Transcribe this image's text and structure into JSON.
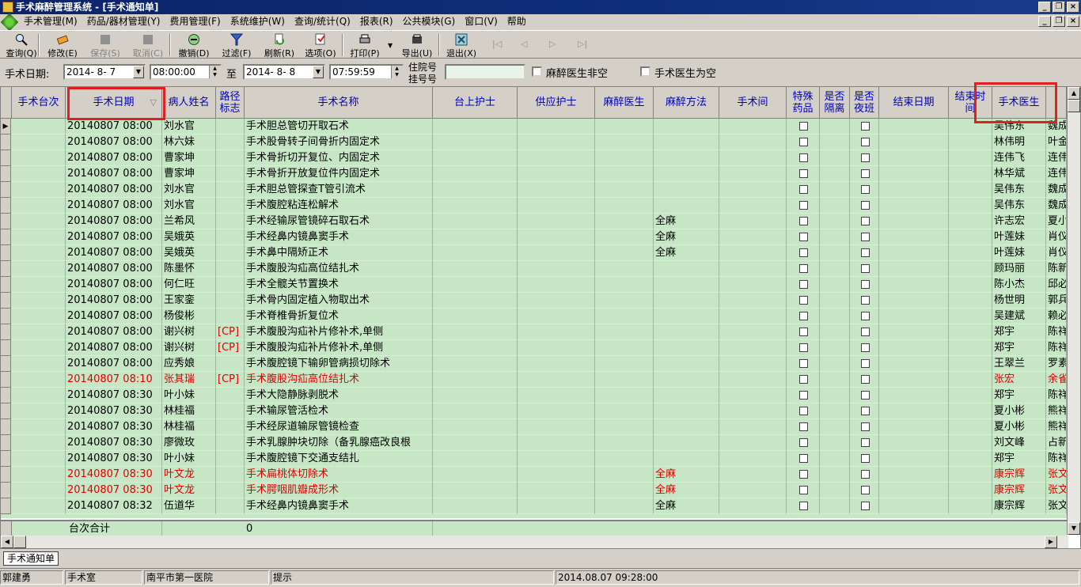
{
  "window": {
    "title": "手术麻醉管理系统 - [手术通知单]"
  },
  "menu": [
    "手术管理(M)",
    "药品/器材管理(Y)",
    "费用管理(F)",
    "系统维护(W)",
    "查询/统计(Q)",
    "报表(R)",
    "公共模块(G)",
    "窗口(V)",
    "帮助"
  ],
  "toolbar": [
    {
      "label": "查询(Q)",
      "icon": "search-icon",
      "enabled": true
    },
    {
      "label": "修改(E)",
      "icon": "edit-icon",
      "enabled": true
    },
    {
      "label": "保存(S)",
      "icon": "save-icon",
      "enabled": false
    },
    {
      "label": "取消(C)",
      "icon": "cancel-icon",
      "enabled": false
    },
    {
      "label": "撤销(D)",
      "icon": "revoke-icon",
      "enabled": true
    },
    {
      "label": "过滤(F)",
      "icon": "filter-icon",
      "enabled": true
    },
    {
      "label": "刷新(R)",
      "icon": "refresh-icon",
      "enabled": true
    },
    {
      "label": "选项(O)",
      "icon": "options-icon",
      "enabled": true
    },
    {
      "label": "打印(P)",
      "icon": "print-icon",
      "enabled": true
    },
    {
      "label": "导出(U)",
      "icon": "export-icon",
      "enabled": true
    },
    {
      "label": "退出(X)",
      "icon": "exit-icon",
      "enabled": true
    }
  ],
  "nav_glyphs": [
    "|◁",
    "◁",
    "▷",
    "▷|"
  ],
  "filter": {
    "date_label": "手术日期:",
    "start_date": "2014- 8- 7",
    "start_time": "08:00:00",
    "to_label": "至",
    "end_date": "2014- 8- 8",
    "end_time": "07:59:59",
    "inpatient_label_1": "住院号",
    "inpatient_label_2": "挂号号",
    "inpatient_value": "",
    "anesth_not_empty": "麻醉医生非空",
    "surgeon_empty": "手术医生为空"
  },
  "columns": {
    "order": "手术台次",
    "date": "手术日期",
    "patient": "病人姓名",
    "path_1": "路径",
    "path_2": "标志",
    "name": "手术名称",
    "scrub": "台上护士",
    "supply": "供应护士",
    "anesth_doc": "麻醉医生",
    "anesth_method": "麻醉方法",
    "room": "手术间",
    "special_1": "特殊",
    "special_2": "药品",
    "iso_1": "是否",
    "iso_2": "隔离",
    "night_1": "是否",
    "night_2": "夜班",
    "end_date": "结束日期",
    "end_time_1": "结束时",
    "end_time_2": "间",
    "surgeon": "手术医生",
    "sort_glyph": "▽"
  },
  "rows": [
    {
      "date": "20140807 08:00",
      "patient": "刘水官",
      "path": "",
      "name": "手术胆总管切开取石术",
      "method": "",
      "surgeon": "吴伟东",
      "extra": "魏成",
      "red": false
    },
    {
      "date": "20140807 08:00",
      "patient": "林六妹",
      "path": "",
      "name": "手术股骨转子间骨折内固定术",
      "method": "",
      "surgeon": "林伟明",
      "extra": "叶金",
      "red": false
    },
    {
      "date": "20140807 08:00",
      "patient": "曹家坤",
      "path": "",
      "name": "手术骨折切开复位、内固定术",
      "method": "",
      "surgeon": "连伟飞",
      "extra": "连伟",
      "red": false
    },
    {
      "date": "20140807 08:00",
      "patient": "曹家坤",
      "path": "",
      "name": "手术骨折开放复位件内固定术",
      "method": "",
      "surgeon": "林华斌",
      "extra": "连伟",
      "red": false
    },
    {
      "date": "20140807 08:00",
      "patient": "刘水官",
      "path": "",
      "name": "手术胆总管探查T管引流术",
      "method": "",
      "surgeon": "吴伟东",
      "extra": "魏成",
      "red": false
    },
    {
      "date": "20140807 08:00",
      "patient": "刘水官",
      "path": "",
      "name": "手术腹腔粘连松解术",
      "method": "",
      "surgeon": "吴伟东",
      "extra": "魏成",
      "red": false
    },
    {
      "date": "20140807 08:00",
      "patient": "兰希风",
      "path": "",
      "name": "手术经输尿管镜碎石取石术",
      "method": "全麻",
      "surgeon": "许志宏",
      "extra": "夏小",
      "red": false
    },
    {
      "date": "20140807 08:00",
      "patient": "吴娥英",
      "path": "",
      "name": "手术经鼻内镜鼻窦手术",
      "method": "全麻",
      "surgeon": "叶莲妹",
      "extra": "肖仪",
      "red": false
    },
    {
      "date": "20140807 08:00",
      "patient": "吴娥英",
      "path": "",
      "name": "手术鼻中隔矫正术",
      "method": "全麻",
      "surgeon": "叶莲妹",
      "extra": "肖仪",
      "red": false
    },
    {
      "date": "20140807 08:00",
      "patient": "陈墨怀",
      "path": "",
      "name": "手术腹股沟疝高位结扎术",
      "method": "",
      "surgeon": "顾玛丽",
      "extra": "陈新",
      "red": false
    },
    {
      "date": "20140807 08:00",
      "patient": "何仁旺",
      "path": "",
      "name": "手术全髋关节置换术",
      "method": "",
      "surgeon": "陈小杰",
      "extra": "邱必",
      "red": false
    },
    {
      "date": "20140807 08:00",
      "patient": "王家銮",
      "path": "",
      "name": "手术骨内固定植入物取出术",
      "method": "",
      "surgeon": "杨世明",
      "extra": "郭兵",
      "red": false
    },
    {
      "date": "20140807 08:00",
      "patient": "杨俊彬",
      "path": "",
      "name": "手术脊椎骨折复位术",
      "method": "",
      "surgeon": "吴建斌",
      "extra": "赖必",
      "red": false
    },
    {
      "date": "20140807 08:00",
      "patient": "谢兴树",
      "path": "[CP]",
      "name": "手术腹股沟疝补片修补术,单侧",
      "method": "",
      "surgeon": "郑宇",
      "extra": "陈祥",
      "red": false
    },
    {
      "date": "20140807 08:00",
      "patient": "谢兴树",
      "path": "[CP]",
      "name": "手术腹股沟疝补片修补术,单侧",
      "method": "",
      "surgeon": "郑宇",
      "extra": "陈祥",
      "red": false
    },
    {
      "date": "20140807 08:00",
      "patient": "应秀娘",
      "path": "",
      "name": "手术腹腔镜下输卵管病损切除术",
      "method": "",
      "surgeon": "王翠兰",
      "extra": "罗素",
      "red": false
    },
    {
      "date": "20140807 08:10",
      "patient": "张其瑞",
      "path": "[CP]",
      "name": "手术腹股沟疝高位结扎术",
      "method": "",
      "surgeon": "张宏",
      "extra": "余雀",
      "red": true
    },
    {
      "date": "20140807 08:30",
      "patient": "叶小妹",
      "path": "",
      "name": "手术大隐静脉剥脱术",
      "method": "",
      "surgeon": "郑宇",
      "extra": "陈祥",
      "red": false
    },
    {
      "date": "20140807 08:30",
      "patient": "林桂福",
      "path": "",
      "name": "手术输尿管活检术",
      "method": "",
      "surgeon": "夏小彬",
      "extra": "熊祥",
      "red": false
    },
    {
      "date": "20140807 08:30",
      "patient": "林桂福",
      "path": "",
      "name": "手术经尿道输尿管镜检查",
      "method": "",
      "surgeon": "夏小彬",
      "extra": "熊祥",
      "red": false
    },
    {
      "date": "20140807 08:30",
      "patient": "廖微玫",
      "path": "",
      "name": "手术乳腺肿块切除（备乳腺癌改良根",
      "method": "",
      "surgeon": "刘文峰",
      "extra": "占新",
      "red": false
    },
    {
      "date": "20140807 08:30",
      "patient": "叶小妹",
      "path": "",
      "name": "手术腹腔镜下交通支结扎",
      "method": "",
      "surgeon": "郑宇",
      "extra": "陈祥",
      "red": false
    },
    {
      "date": "20140807 08:30",
      "patient": "叶文龙",
      "path": "",
      "name": "手术扁桃体切除术",
      "method": "全麻",
      "surgeon": "康宗辉",
      "extra": "张文",
      "red": true
    },
    {
      "date": "20140807 08:30",
      "patient": "叶文龙",
      "path": "",
      "name": "手术腭咽肌瓣成形术",
      "method": "全麻",
      "surgeon": "康宗辉",
      "extra": "张文",
      "red": true
    },
    {
      "date": "20140807 08:32",
      "patient": "伍道华",
      "path": "",
      "name": "手术经鼻内镜鼻窦手术",
      "method": "全麻",
      "surgeon": "康宗辉",
      "extra": "张文",
      "red": false
    }
  ],
  "summary": {
    "label": "台次合计",
    "value": "0"
  },
  "tab": "手术通知单",
  "status": {
    "user": "郭建勇",
    "dept": "手术室",
    "hospital": "南平市第一医院",
    "hint": "提示",
    "time": "2014.08.07 09:28:00"
  }
}
